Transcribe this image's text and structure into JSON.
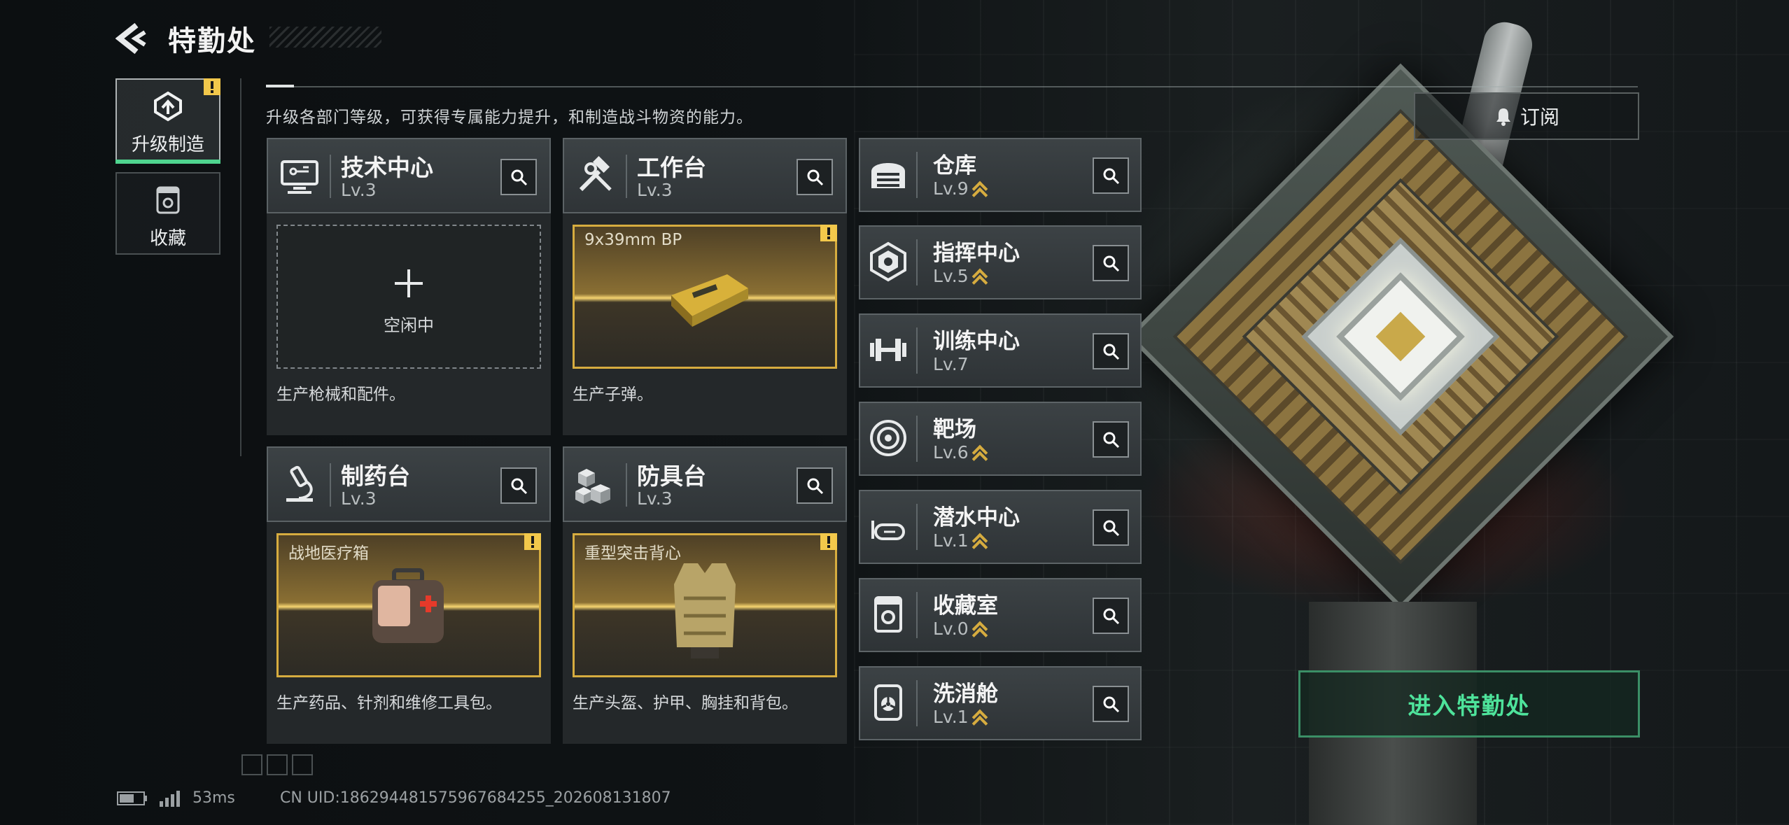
{
  "header": {
    "title": "特勤处"
  },
  "sidebar": {
    "items": [
      {
        "label": "升级制造",
        "icon": "upgrade-icon",
        "active": true,
        "badge": "!"
      },
      {
        "label": "收藏",
        "icon": "collection-icon",
        "active": false
      }
    ]
  },
  "description": "升级各部门等级，可获得专属能力提升，和制造战斗物资的能力。",
  "subscribe": {
    "label": "订阅",
    "icon": "bell-icon"
  },
  "workstations": [
    {
      "name": "技术中心",
      "level": "Lv.3",
      "icon": "computer-icon",
      "slot_state": "empty",
      "idle_label": "空闲中",
      "product": "",
      "footer": "生产枪械和配件。"
    },
    {
      "name": "工作台",
      "level": "Lv.3",
      "icon": "hammer-wrench-icon",
      "slot_state": "producing",
      "product": "9x39mm BP",
      "footer": "生产子弹。"
    },
    {
      "name": "制药台",
      "level": "Lv.3",
      "icon": "microscope-icon",
      "slot_state": "producing",
      "product": "战地医疗箱",
      "footer": "生产药品、针剂和维修工具包。"
    },
    {
      "name": "防具台",
      "level": "Lv.3",
      "icon": "cubes-icon",
      "slot_state": "producing",
      "product": "重型突击背心",
      "footer": "生产头盔、护甲、胸挂和背包。"
    }
  ],
  "facilities": [
    {
      "name": "仓库",
      "level": "Lv.9",
      "upgradable": true,
      "icon": "warehouse-icon"
    },
    {
      "name": "指挥中心",
      "level": "Lv.5",
      "upgradable": true,
      "icon": "command-icon"
    },
    {
      "name": "训练中心",
      "level": "Lv.7",
      "upgradable": false,
      "icon": "dumbbell-icon"
    },
    {
      "name": "靶场",
      "level": "Lv.6",
      "upgradable": true,
      "icon": "target-icon"
    },
    {
      "name": "潜水中心",
      "level": "Lv.1",
      "upgradable": true,
      "icon": "diving-mask-icon"
    },
    {
      "name": "收藏室",
      "level": "Lv.0",
      "upgradable": true,
      "icon": "vault-icon"
    },
    {
      "name": "洗消舱",
      "level": "Lv.1",
      "upgradable": true,
      "icon": "decon-icon"
    }
  ],
  "enter_button": {
    "label": "进入特勤处"
  },
  "status_bar": {
    "ping": "53ms",
    "uid": "CN UID:1862944815759676842​55_202608131807"
  },
  "colors": {
    "accent_green": "#4ee39b",
    "gold": "#d6ac3f",
    "warning": "#f2c84b"
  }
}
